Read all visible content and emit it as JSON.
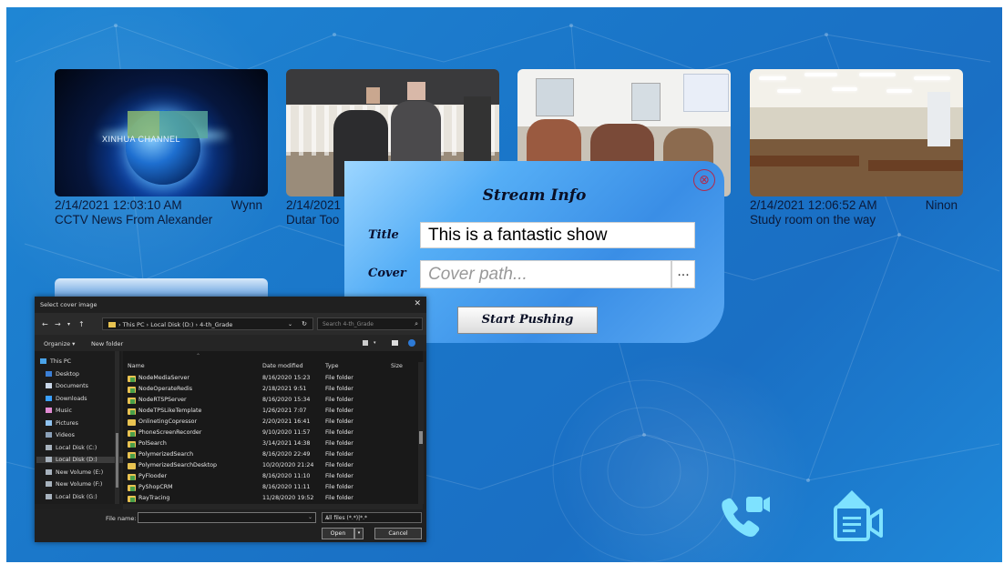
{
  "tiles": [
    {
      "date": "2/14/2021 12:03:10 AM",
      "user": "Wynn",
      "name": "CCTV News From Alexander",
      "overlay_text": "XINHUA CHANNEL"
    },
    {
      "date": "2/14/2021",
      "user": "",
      "name": "Dutar Too"
    },
    {
      "date": "",
      "user": "",
      "name": ""
    },
    {
      "date": "2/14/2021 12:06:52 AM",
      "user": "Ninon",
      "name": "Study room on the way"
    }
  ],
  "dialog": {
    "title": "Stream Info",
    "title_label": "Title",
    "title_value": "This is a fantastic show",
    "cover_label": "Cover",
    "cover_placeholder": "Cover path...",
    "browse_label": "...",
    "start_label": "Start Pushing",
    "close_glyph": "⊗"
  },
  "file_dialog": {
    "title": "Select cover image",
    "close_glyph": "✕",
    "path": [
      "This PC",
      "Local Disk (D:)",
      "4-th_Grade"
    ],
    "search_placeholder": "Search 4-th_Grade",
    "organize": "Organize ▾",
    "new_folder": "New folder",
    "nav_items": [
      {
        "label": "This PC",
        "color": "#4aa3e8"
      },
      {
        "label": "Desktop",
        "color": "#3b7fd6"
      },
      {
        "label": "Documents",
        "color": "#c9d6e8"
      },
      {
        "label": "Downloads",
        "color": "#3aa0ff"
      },
      {
        "label": "Music",
        "color": "#e08bd2"
      },
      {
        "label": "Pictures",
        "color": "#8fc3f0"
      },
      {
        "label": "Videos",
        "color": "#8aa0b8"
      },
      {
        "label": "Local Disk (C:)",
        "color": "#a7b2bd"
      },
      {
        "label": "Local Disk (D:)",
        "color": "#a7b2bd"
      },
      {
        "label": "New Volume (E:)",
        "color": "#a7b2bd"
      },
      {
        "label": "New Volume (F:)",
        "color": "#a7b2bd"
      },
      {
        "label": "Local Disk (G:)",
        "color": "#a7b2bd"
      }
    ],
    "selected_nav": "Local Disk (D:)",
    "columns": {
      "name": "Name",
      "date": "Date modified",
      "type": "Type",
      "size": "Size"
    },
    "files": [
      {
        "name": "NodeMediaServer",
        "date": "8/16/2020 15:23",
        "type": "File folder",
        "vs": true
      },
      {
        "name": "NodeOperateRedis",
        "date": "2/18/2021 9:51",
        "type": "File folder",
        "vs": true
      },
      {
        "name": "NodeRTSPServer",
        "date": "8/16/2020 15:34",
        "type": "File folder",
        "vs": true
      },
      {
        "name": "NodeTPSLikeTemplate",
        "date": "1/26/2021 7:07",
        "type": "File folder",
        "vs": true
      },
      {
        "name": "OnlinetingCopressor",
        "date": "2/20/2021 16:41",
        "type": "File folder",
        "vs": false
      },
      {
        "name": "PhoneScreenRecorder",
        "date": "9/10/2020 11:57",
        "type": "File folder",
        "vs": true
      },
      {
        "name": "PolSearch",
        "date": "3/14/2021 14:38",
        "type": "File folder",
        "vs": true
      },
      {
        "name": "PolymerizedSearch",
        "date": "8/16/2020 22:49",
        "type": "File folder",
        "vs": true
      },
      {
        "name": "PolymerizedSearchDesktop",
        "date": "10/20/2020 21:24",
        "type": "File folder",
        "vs": false
      },
      {
        "name": "PyFlooder",
        "date": "8/16/2020 11:10",
        "type": "File folder",
        "vs": true
      },
      {
        "name": "PyShopCRM",
        "date": "8/16/2020 11:11",
        "type": "File folder",
        "vs": true
      },
      {
        "name": "RayTracing",
        "date": "11/28/2020 19:52",
        "type": "File folder",
        "vs": true
      }
    ],
    "filename_label": "File name:",
    "filename_value": "",
    "filter": "All files (*.*)|*.*",
    "open_label": "Open",
    "cancel_label": "Cancel"
  },
  "icons": {
    "video_call": "video-call-icon",
    "upload_stream": "upload-stream-icon"
  },
  "colors": {
    "accent": "#1a7ccc",
    "icon": "#7ee2ff"
  }
}
